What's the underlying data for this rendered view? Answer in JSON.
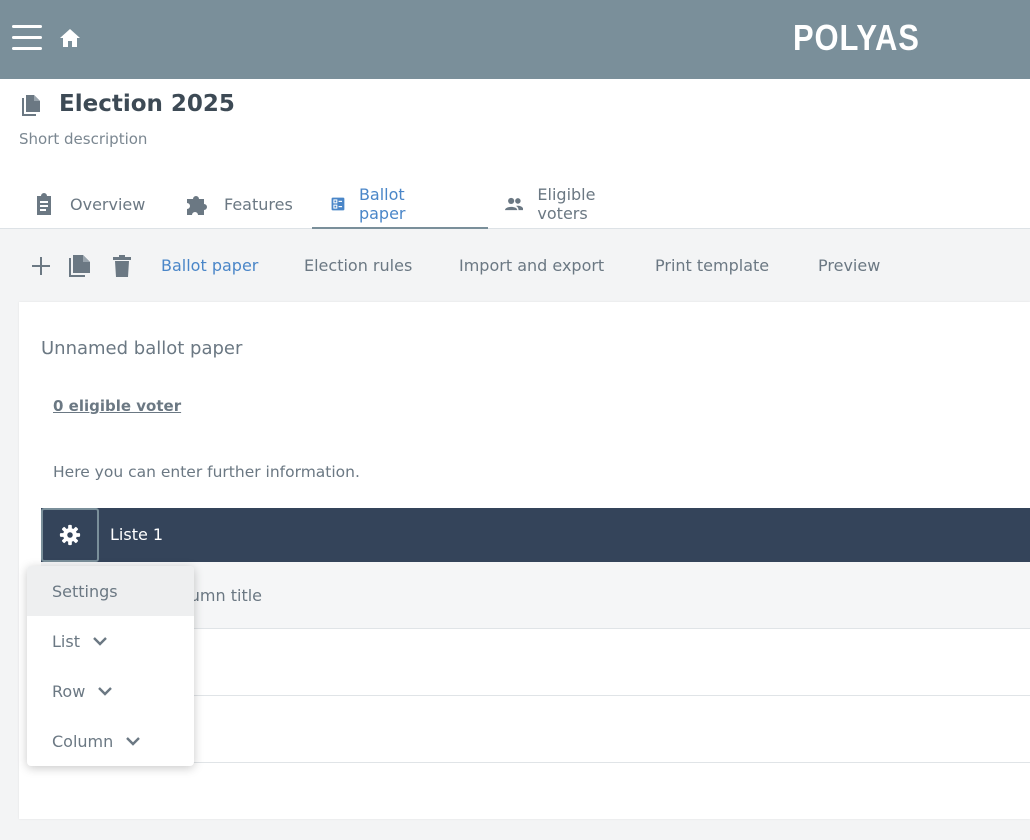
{
  "header": {
    "brand": "POLYAS",
    "menu_icon": "hamburger-menu-icon",
    "home_icon": "home-icon"
  },
  "election": {
    "title": "Election 2025",
    "description": "Short description"
  },
  "tabs": [
    {
      "label": "Overview",
      "icon": "clipboard-icon",
      "active": false
    },
    {
      "label": "Features",
      "icon": "puzzle-icon",
      "active": false
    },
    {
      "label": "Ballot paper",
      "icon": "ballot-list-icon",
      "active": true
    },
    {
      "label": "Eligible voters",
      "icon": "people-icon",
      "active": false
    }
  ],
  "subnav": {
    "actions": [
      "plus-icon",
      "copy-icon",
      "trash-icon"
    ],
    "items": [
      {
        "label": "Ballot paper",
        "active": true
      },
      {
        "label": "Election rules",
        "active": false
      },
      {
        "label": "Import and export",
        "active": false
      },
      {
        "label": "Print template",
        "active": false
      },
      {
        "label": "Preview",
        "active": false
      }
    ]
  },
  "ballot": {
    "name": "Unnamed ballot paper",
    "eligible_voters_link": "0 eligible voter",
    "info": "Here you can enter further information.",
    "list_title": "Liste 1",
    "column_title": "Column title"
  },
  "menu": {
    "items": [
      {
        "label": "Settings",
        "has_chevron": false,
        "selected": true
      },
      {
        "label": "List",
        "has_chevron": true,
        "selected": false
      },
      {
        "label": "Row",
        "has_chevron": true,
        "selected": false
      },
      {
        "label": "Column",
        "has_chevron": true,
        "selected": false
      }
    ]
  },
  "colors": {
    "topbar": "#7a8f9a",
    "accent": "#4a86c8",
    "list_header": "#34445a"
  }
}
